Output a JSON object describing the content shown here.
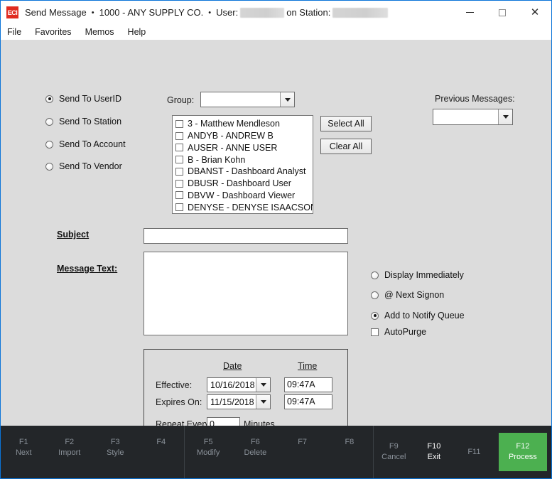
{
  "window": {
    "app_icon_text": "ECI",
    "title": "Send Message",
    "company": "1000 - ANY SUPPLY CO.",
    "user_label": "User:",
    "station_label": "on Station:",
    "separator": "•",
    "controls": {
      "minimize": "minimize-icon",
      "maximize": "maximize-icon",
      "close": "close-icon"
    }
  },
  "menu": {
    "items": [
      {
        "label": "File"
      },
      {
        "label": "Favorites"
      },
      {
        "label": "Memos"
      },
      {
        "label": "Help"
      }
    ]
  },
  "send_to": {
    "options": [
      {
        "label": "Send To UserID",
        "selected": true
      },
      {
        "label": "Send To Station",
        "selected": false
      },
      {
        "label": "Send To Account",
        "selected": false
      },
      {
        "label": "Send To Vendor",
        "selected": false
      }
    ]
  },
  "group": {
    "label": "Group:",
    "value": "",
    "placeholder": ""
  },
  "recipients": {
    "items": [
      {
        "label": "3 - Matthew Mendleson",
        "checked": false
      },
      {
        "label": "ANDYB - ANDREW B",
        "checked": false
      },
      {
        "label": "AUSER - ANNE USER",
        "checked": false
      },
      {
        "label": "B - Brian Kohn",
        "checked": false
      },
      {
        "label": "DBANST - Dashboard Analyst",
        "checked": false
      },
      {
        "label": "DBUSR - Dashboard User",
        "checked": false
      },
      {
        "label": "DBVW - Dashboard Viewer",
        "checked": false
      },
      {
        "label": "DENYSE - DENYSE ISAACSON",
        "checked": false
      }
    ],
    "scroll_up_icon": "chevron-up-icon",
    "scroll_down_icon": "chevron-down-icon"
  },
  "buttons": {
    "select_all": "Select All",
    "clear_all": "Clear All"
  },
  "previous_messages": {
    "label": "Previous Messages:",
    "value": ""
  },
  "subject": {
    "label": "Subject ",
    "value": ""
  },
  "message_text": {
    "label": "Message Text:",
    "value": ""
  },
  "delivery": {
    "options": [
      {
        "label": "Display Immediately",
        "selected": false
      },
      {
        "label": "@ Next Signon",
        "selected": false
      },
      {
        "label": "Add to Notify Queue",
        "selected": true
      }
    ],
    "autopurge": {
      "label": "AutoPurge",
      "checked": false
    }
  },
  "schedule": {
    "date_header": "Date",
    "time_header": "Time",
    "effective_label": "Effective:",
    "effective_date": "10/16/2018",
    "effective_time": "09:47A",
    "expires_label": "Expires On:",
    "expires_date": "11/15/2018",
    "expires_time": "09:47A",
    "repeat_label": "Repeat Every",
    "repeat_value": "0",
    "minutes_label": "Minutes"
  },
  "function_bar": {
    "group1": [
      {
        "key": "F1",
        "name": "Next",
        "state": "dim"
      },
      {
        "key": "F2",
        "name": "Import",
        "state": "dim"
      },
      {
        "key": "F3",
        "name": "Style",
        "state": "dim"
      },
      {
        "key": "F4",
        "name": "",
        "state": "dim"
      }
    ],
    "group2": [
      {
        "key": "F5",
        "name": "Modify",
        "state": "dim"
      },
      {
        "key": "F6",
        "name": "Delete",
        "state": "dim"
      },
      {
        "key": "F7",
        "name": "",
        "state": "dim"
      },
      {
        "key": "F8",
        "name": "",
        "state": "dim"
      }
    ],
    "group3": [
      {
        "key": "F9",
        "name": "Cancel",
        "state": "dim"
      },
      {
        "key": "F10",
        "name": "Exit",
        "state": "active"
      },
      {
        "key": "F11",
        "name": "",
        "state": "dim"
      },
      {
        "key": "F12",
        "name": "Process",
        "state": "green"
      }
    ]
  },
  "colors": {
    "accent_border": "#0a74d8",
    "form_bg": "#dcdcdc",
    "fnbar_bg": "#232629",
    "process_green": "#4cb050",
    "app_icon_red": "#e02b20"
  }
}
